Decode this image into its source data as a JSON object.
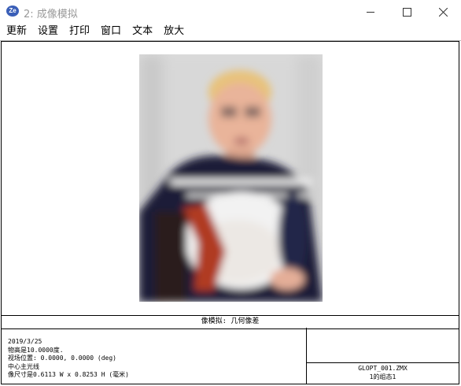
{
  "window": {
    "title": "2: 成像模拟",
    "app_icon_text": "Ze"
  },
  "menu": {
    "items": [
      "更新",
      "设置",
      "打印",
      "窗口",
      "文本",
      "放大"
    ]
  },
  "simulation": {
    "caption": "像模拟: 几何像差",
    "info_lines": [
      "2019/3/25",
      "物高是10.0000度.",
      "视场位置: 0.0000, 0.0000 (deg)",
      "中心主光线",
      "像尺寸是0.6113 W x 0.8253 H (毫米)"
    ],
    "file_name": "GLOPT_001.ZMX",
    "config": "1的组态1"
  }
}
